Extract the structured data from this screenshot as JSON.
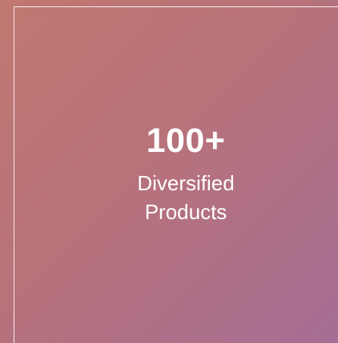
{
  "stat": {
    "number": "100+",
    "label_line1": "Diversified",
    "label_line2": "Products"
  },
  "colors": {
    "gradient_start": "#c07870",
    "gradient_end": "#a66e95",
    "text": "#ffffff",
    "frame": "#ffffff"
  }
}
